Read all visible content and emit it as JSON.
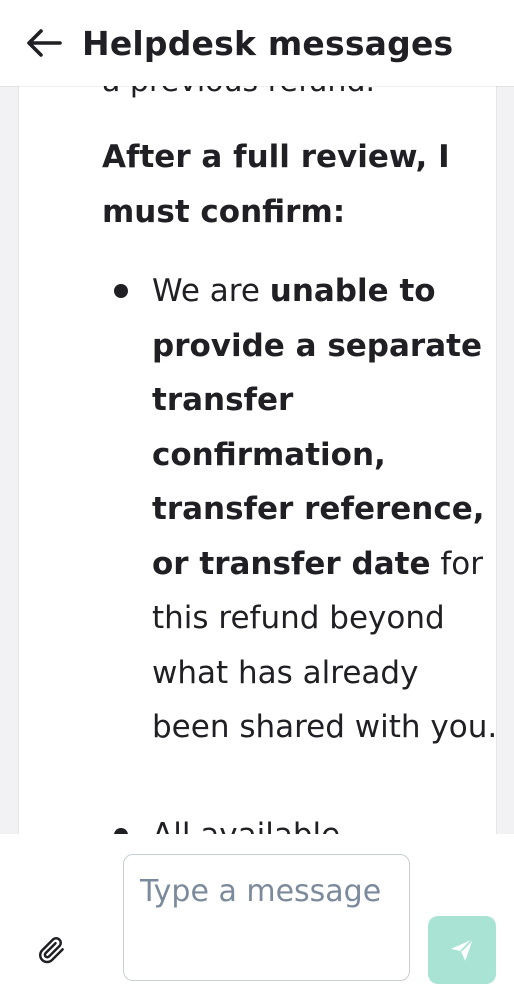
{
  "header": {
    "back_icon": "arrow-left-icon",
    "title": "Helpdesk messages"
  },
  "message": {
    "clipped_previous_line": "a previous refund.",
    "heading": "After a full review, I must confirm:",
    "bullets": [
      {
        "normal_1": "We are ",
        "bold_1": "unable to provide a separate transfer confirmation, transfer reference, or transfer date",
        "normal_2": " for this refund beyond what has already been shared with you."
      },
      {
        "normal_1": "All available"
      }
    ]
  },
  "composer": {
    "attach_icon": "paperclip-icon",
    "input_placeholder": "Type a message",
    "input_value": "",
    "send_icon": "send-icon"
  },
  "colors": {
    "send_button_bg": "#a9e3d4",
    "text_primary": "#1f1f24",
    "placeholder": "#7b8a9c"
  }
}
